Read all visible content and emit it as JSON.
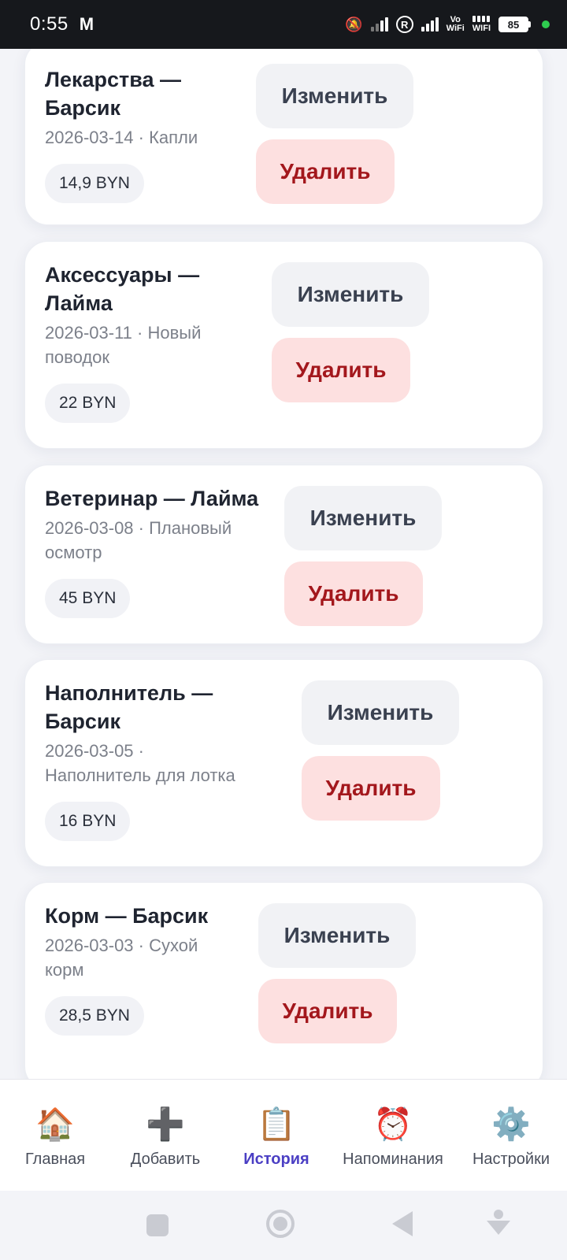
{
  "status_bar": {
    "time": "0:55",
    "mail_icon": "gmail-icon",
    "wifi_label_top": "Vo",
    "wifi_label_bottom": "WiFi",
    "wifi2_label": "WIFI",
    "battery": "85",
    "r_badge": "R"
  },
  "expenses": [
    {
      "title_line1": "Лекарства —",
      "title_line2": "Барсик",
      "sub_line1": "2026-03-14 · Капли",
      "sub_line2": "",
      "amount": "14,9 BYN",
      "edit_label": "Изменить",
      "delete_label": "Удалить"
    },
    {
      "title_line1": "Аксессуары —",
      "title_line2": "Лайма",
      "sub_line1": "2026-03-11 · Новый",
      "sub_line2": "поводок",
      "amount": "22 BYN",
      "edit_label": "Изменить",
      "delete_label": "Удалить"
    },
    {
      "title_line1": "Ветеринар — Лайма",
      "title_line2": "",
      "sub_line1": "2026-03-08 · Плановый",
      "sub_line2": "осмотр",
      "amount": "45 BYN",
      "edit_label": "Изменить",
      "delete_label": "Удалить"
    },
    {
      "title_line1": "Наполнитель —",
      "title_line2": "Барсик",
      "sub_line1": "2026-03-05 ·",
      "sub_line2": "Наполнитель для лотка",
      "amount": "16 BYN",
      "edit_label": "Изменить",
      "delete_label": "Удалить"
    },
    {
      "title_line1": "Корм — Барсик",
      "title_line2": "",
      "sub_line1": "2026-03-03 · Сухой",
      "sub_line2": "корм",
      "amount": "28,5 BYN",
      "edit_label": "Изменить",
      "delete_label": "Удалить"
    }
  ],
  "bottom_nav": [
    {
      "icon": "🏠",
      "icon_name": "home-icon",
      "label": "Главная",
      "active": false
    },
    {
      "icon": "➕",
      "icon_name": "plus-icon",
      "label": "Добавить",
      "active": false
    },
    {
      "icon": "📋",
      "icon_name": "clipboard-icon",
      "label": "История",
      "active": true
    },
    {
      "icon": "⏰",
      "icon_name": "alarm-clock-icon",
      "label": "Напоминания",
      "active": false
    },
    {
      "icon": "⚙️",
      "icon_name": "gear-icon",
      "label": "Настройки",
      "active": false
    }
  ],
  "colors": {
    "active_nav": "#4b3fc4",
    "delete_bg": "#fde0e0",
    "delete_text": "#a3171c",
    "edit_bg": "#f1f2f5"
  }
}
